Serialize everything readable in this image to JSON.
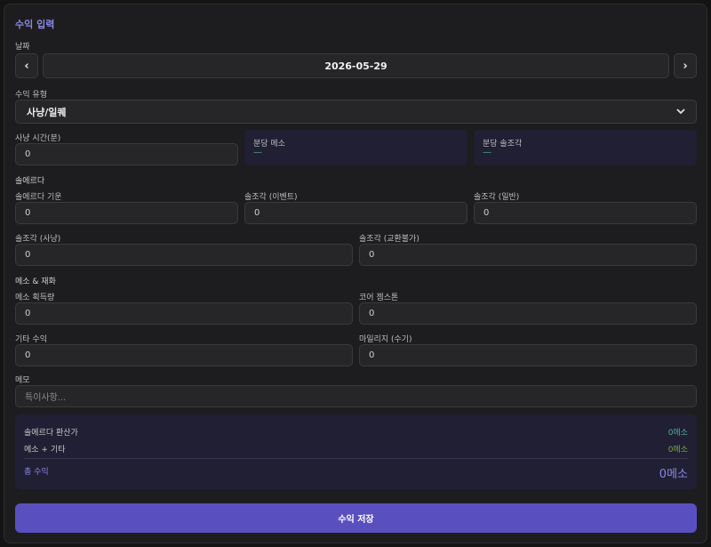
{
  "panel": {
    "title": "수익 입력"
  },
  "date": {
    "label": "날짜",
    "value": "2026-05-29",
    "prev_icon": "chevron-left-icon",
    "next_icon": "chevron-right-icon",
    "prev_glyph": "‹",
    "next_glyph": "›"
  },
  "income_type": {
    "label": "수익 유형",
    "selected": "사냥/일퀘"
  },
  "hunting": {
    "time_label": "사냥 시간(분)",
    "time_value": "0",
    "meso_per_min_label": "분당 메소",
    "meso_per_min_value": "—",
    "sol_per_min_label": "분당 솔조각",
    "sol_per_min_value": "—"
  },
  "sol_erda": {
    "section": "솔에르다",
    "gauge_label": "솔에르다 기운",
    "gauge_value": "0",
    "event_label": "솔조각 (이벤트)",
    "event_value": "0",
    "normal_label": "솔조각 (일반)",
    "normal_value": "0",
    "hunt_label": "솔조각 (사냥)",
    "hunt_value": "0",
    "untradable_label": "솔조각 (교환불가)",
    "untradable_value": "0"
  },
  "meso_goods": {
    "section": "메소 & 재화",
    "meso_label": "메소 획득량",
    "meso_value": "0",
    "core_label": "코어 젬스톤",
    "core_value": "0",
    "other_label": "기타 수익",
    "other_value": "0",
    "mileage_label": "마일리지 (수기)",
    "mileage_value": "0"
  },
  "memo": {
    "label": "메모",
    "placeholder": "특이사항..."
  },
  "summary": {
    "sol_label": "솔에르다 환산가",
    "sol_value": "0메소",
    "meso_label": "메소 + 기타",
    "meso_value": "0메소",
    "total_label": "총 수익",
    "total_value": "0메소"
  },
  "save_button": "수익 저장",
  "colors": {
    "accent": "#8b87e6",
    "button": "#5a4fbf",
    "teal": "#4fae95",
    "green": "#7aa84a"
  }
}
